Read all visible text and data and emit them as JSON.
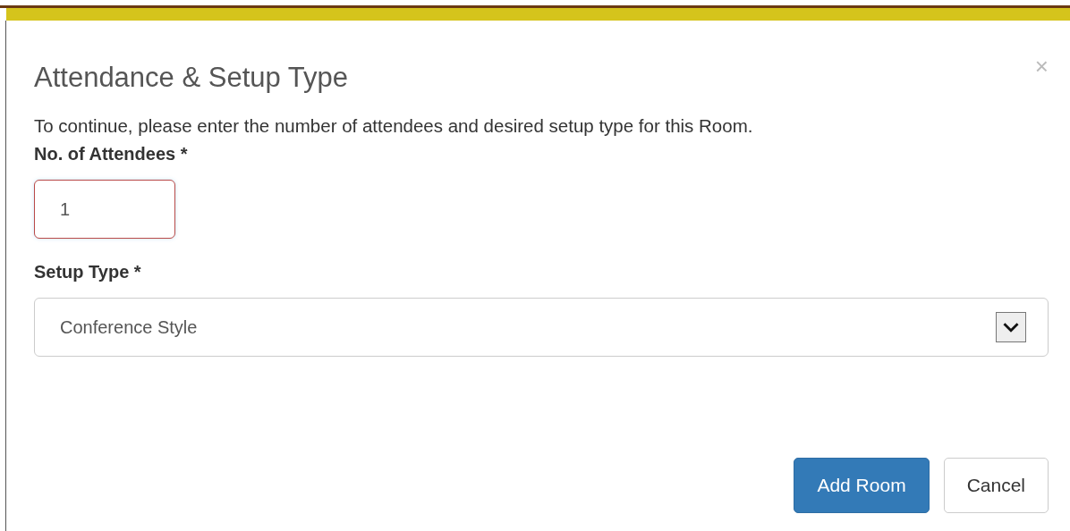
{
  "dialog": {
    "title": "Attendance & Setup Type",
    "close": "×",
    "intro": "To continue, please enter the number of attendees and desired setup type for this Room."
  },
  "fields": [
    {
      "kind": "input",
      "label": "No. of Attendees *",
      "value": "1",
      "invalid": true
    },
    {
      "kind": "select",
      "label": "Setup Type *",
      "value": "Conference Style",
      "invalid": false
    }
  ],
  "buttons": [
    {
      "label": "Add Room",
      "primary": true
    },
    {
      "label": "Cancel",
      "primary": false
    }
  ]
}
